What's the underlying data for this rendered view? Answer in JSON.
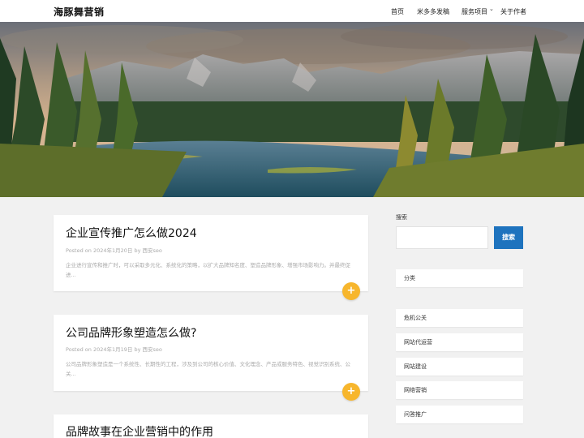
{
  "header": {
    "site_title": "海豚舞营销",
    "nav": {
      "home": "首页",
      "mi": "米多多发稿",
      "services": "服务项目",
      "about": "关于作者"
    }
  },
  "posts": [
    {
      "title": "企业宣传推广怎么做2024",
      "meta": "Posted on 2024年1月20日 by 西安seo",
      "excerpt": "企业进行宣传和推广时，可以采取多元化、系统化的策略，以扩大品牌知名度、塑造品牌形象、增强市场影响力。并最终促进..."
    },
    {
      "title": "公司品牌形象塑造怎么做?",
      "meta": "Posted on 2024年1月19日 by 西安seo",
      "excerpt": "公司品牌形象塑造是一个系统性、长期性的工程，涉及到公司的核心价值、文化理念、产品或服务特色、视觉识别系统、公关..."
    },
    {
      "title": "品牌故事在企业营销中的作用"
    }
  ],
  "sidebar": {
    "search_label": "搜索",
    "search_button": "搜索",
    "categories_title": "分类",
    "categories": [
      "危机公关",
      "网站代运营",
      "网站建设",
      "网络营销",
      "问答推广"
    ]
  },
  "colors": {
    "accent_orange": "#f7b62d",
    "search_blue": "#1e73be"
  },
  "icons": {
    "read_more": "plus-icon",
    "dropdown": "chevron-down-icon"
  }
}
